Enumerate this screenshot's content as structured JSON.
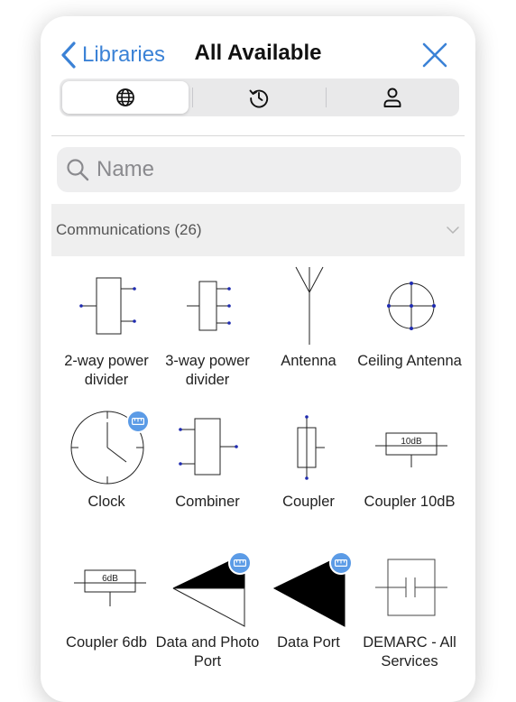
{
  "header": {
    "back_label": "Libraries",
    "title": "All Available"
  },
  "segments": [
    {
      "icon": "globe-icon",
      "selected": true
    },
    {
      "icon": "history-icon",
      "selected": false
    },
    {
      "icon": "person-icon",
      "selected": false
    }
  ],
  "search": {
    "placeholder": "Name",
    "value": ""
  },
  "section": {
    "title": "Communications (26)",
    "expanded": true
  },
  "items": [
    {
      "label": "2-way power divider",
      "badge": false
    },
    {
      "label": "3-way power divider",
      "badge": false
    },
    {
      "label": "Antenna",
      "badge": false
    },
    {
      "label": "Ceiling Antenna",
      "badge": false
    },
    {
      "label": "Clock",
      "badge": true
    },
    {
      "label": "Combiner",
      "badge": false
    },
    {
      "label": "Coupler",
      "badge": false
    },
    {
      "label": "Coupler 10dB",
      "badge": false,
      "box_text": "10dB"
    },
    {
      "label": "Coupler 6db",
      "badge": false,
      "box_text": "6dB"
    },
    {
      "label": "Data and Photo Port",
      "badge": true
    },
    {
      "label": "Data Port",
      "badge": true
    },
    {
      "label": "DEMARC - All Services",
      "badge": false
    }
  ],
  "colors": {
    "accent": "#3b82d6",
    "badge": "#5b9be6",
    "symbol_dot": "#1f2bb0"
  }
}
